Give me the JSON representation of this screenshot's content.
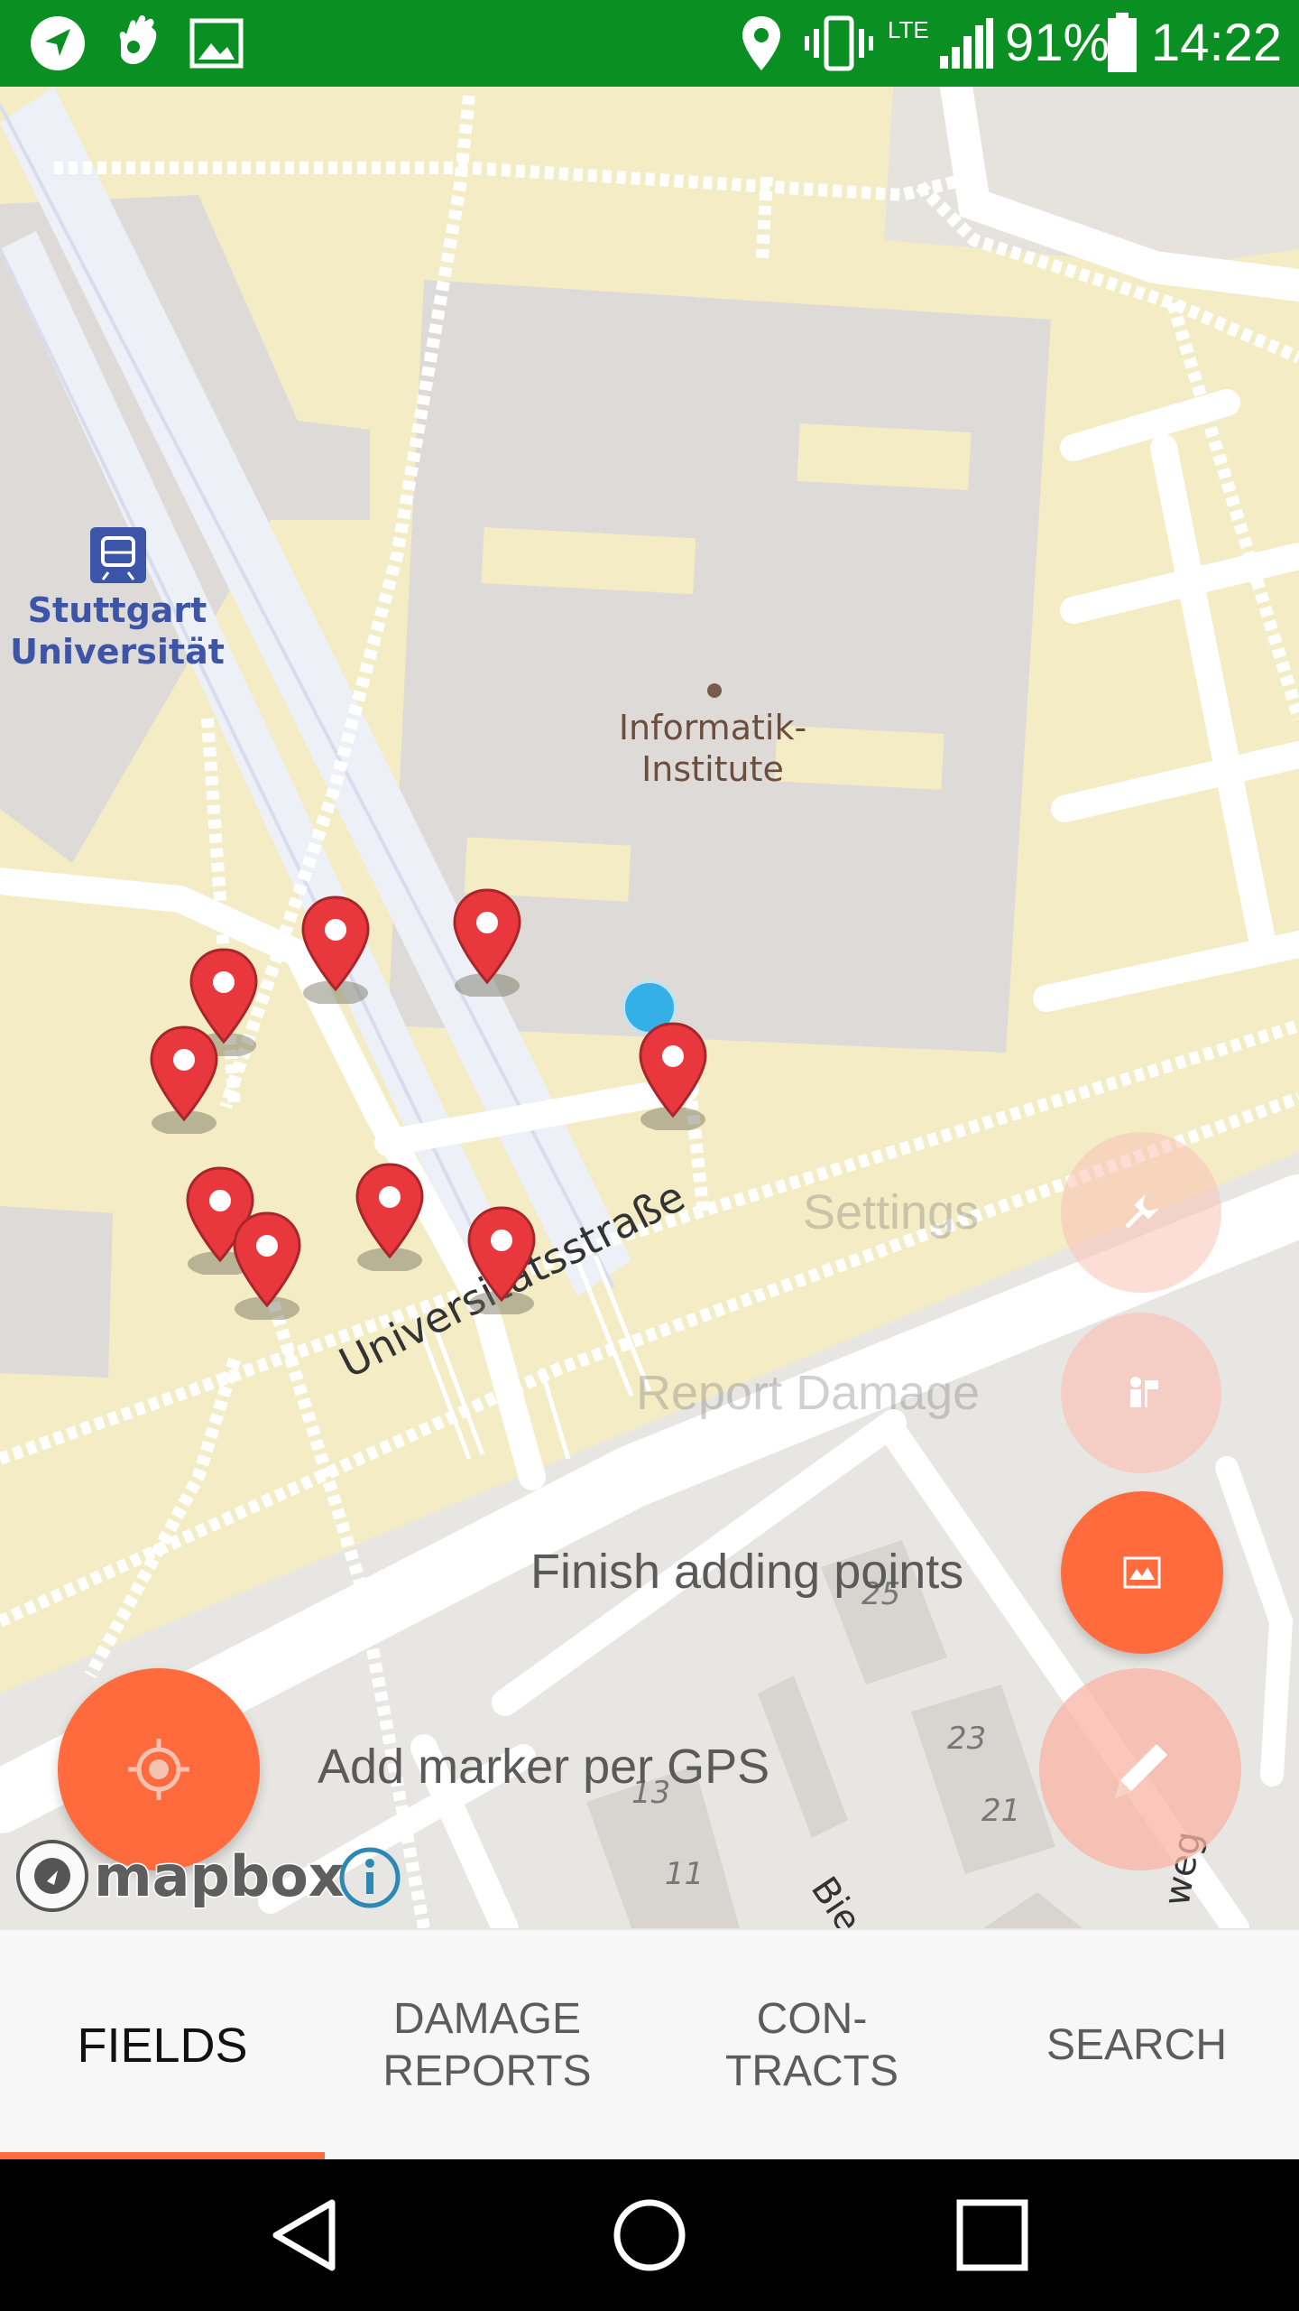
{
  "status_bar": {
    "battery": "91%",
    "time": "14:22",
    "network": "LTE",
    "icons": [
      "navigation-icon",
      "hand-icon",
      "image-icon",
      "location-icon",
      "vibrate-icon",
      "lte-icon",
      "signal-icon",
      "battery-icon"
    ]
  },
  "map": {
    "labels": {
      "station": "Stuttgart\nUniversität",
      "building": "Informatik-\nInstitute",
      "street": "Universitätsstraße",
      "street_partial_1": "Bie",
      "street_partial_2": "weg",
      "house_numbers": [
        "25",
        "23",
        "21",
        "13",
        "11"
      ]
    },
    "attribution": {
      "logo": "mapbox"
    },
    "marker_color": "#e8383d",
    "location_dot_color": "#35b0e6"
  },
  "fab_menu": {
    "settings_label": "Settings",
    "report_damage_label": "Report Damage",
    "finish_label": "Finish adding points",
    "add_marker_label": "Add marker per GPS"
  },
  "tabs": [
    {
      "label": "FIELDS",
      "active": true
    },
    {
      "label": "DAMAGE\nREPORTS",
      "active": false
    },
    {
      "label": "CON-\nTRACTS",
      "active": false
    },
    {
      "label": "SEARCH",
      "active": false
    }
  ],
  "colors": {
    "status_bar": "#0a8f23",
    "accent": "#ff6b3d",
    "fab_faded": "#f9c3b7"
  }
}
